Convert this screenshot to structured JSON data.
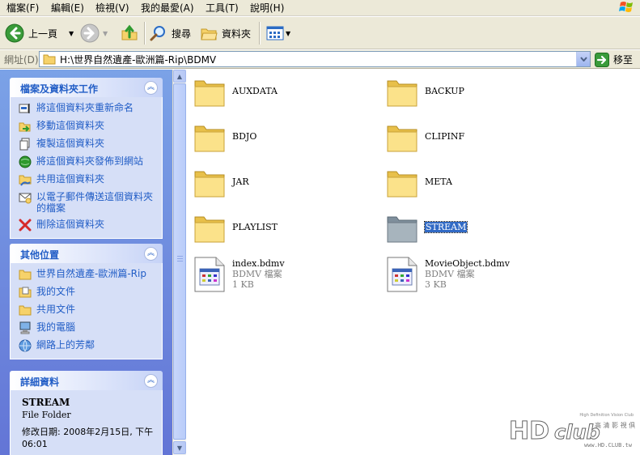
{
  "menu": [
    "檔案(F)",
    "編輯(E)",
    "檢視(V)",
    "我的最愛(A)",
    "工具(T)",
    "說明(H)"
  ],
  "toolbar": {
    "back_label": "上一頁",
    "search_label": "搜尋",
    "folders_label": "資料夾"
  },
  "address": {
    "label": "網址(D)",
    "path": "H:\\世界自然遺產-歐洲篇-Rip\\BDMV",
    "go_label": "移至"
  },
  "panels": {
    "tasks": {
      "title": "檔案及資料夾工作",
      "items": [
        {
          "label": "將這個資料夾重新命名",
          "icon": "rename-icon"
        },
        {
          "label": "移動這個資料夾",
          "icon": "move-icon"
        },
        {
          "label": "複製這個資料夾",
          "icon": "copy-icon"
        },
        {
          "label": "將這個資料夾發佈到網站",
          "icon": "publish-web-icon"
        },
        {
          "label": "共用這個資料夾",
          "icon": "share-folder-icon"
        },
        {
          "label": "以電子郵件傳送這個資料夾的檔案",
          "icon": "email-icon"
        },
        {
          "label": "刪除這個資料夾",
          "icon": "delete-icon"
        }
      ]
    },
    "places": {
      "title": "其他位置",
      "items": [
        {
          "label": "世界自然遺產-歐洲篇-Rip",
          "icon": "folder-icon"
        },
        {
          "label": "我的文件",
          "icon": "my-documents-icon"
        },
        {
          "label": "共用文件",
          "icon": "shared-documents-icon"
        },
        {
          "label": "我的電腦",
          "icon": "my-computer-icon"
        },
        {
          "label": "網路上的芳鄰",
          "icon": "network-places-icon"
        }
      ]
    },
    "details": {
      "title": "詳細資料",
      "name": "STREAM",
      "type": "File Folder",
      "modified": "修改日期: 2008年2月15日, 下午 06:01"
    }
  },
  "files": [
    {
      "name": "AUXDATA",
      "kind": "folder"
    },
    {
      "name": "BACKUP",
      "kind": "folder"
    },
    {
      "name": "BDJO",
      "kind": "folder"
    },
    {
      "name": "CLIPINF",
      "kind": "folder"
    },
    {
      "name": "JAR",
      "kind": "folder"
    },
    {
      "name": "META",
      "kind": "folder"
    },
    {
      "name": "PLAYLIST",
      "kind": "folder"
    },
    {
      "name": "STREAM",
      "kind": "folder",
      "selected": true
    },
    {
      "name": "index.bdmv",
      "kind": "file",
      "type": "BDMV 檔案",
      "size": "1 KB"
    },
    {
      "name": "MovieObject.bdmv",
      "kind": "file",
      "type": "BDMV 檔案",
      "size": "3 KB"
    }
  ],
  "watermark": {
    "tagline": "High Definition Vision Club",
    "chinese": "高 清 影 視 俱 樂 部",
    "url": "www.HD.CLUB.tw"
  },
  "colors": {
    "task_link": "#215dc6",
    "selection": "#316ac5",
    "pane_gradient_top": "#7ba2e7",
    "pane_gradient_bottom": "#6375d6"
  }
}
